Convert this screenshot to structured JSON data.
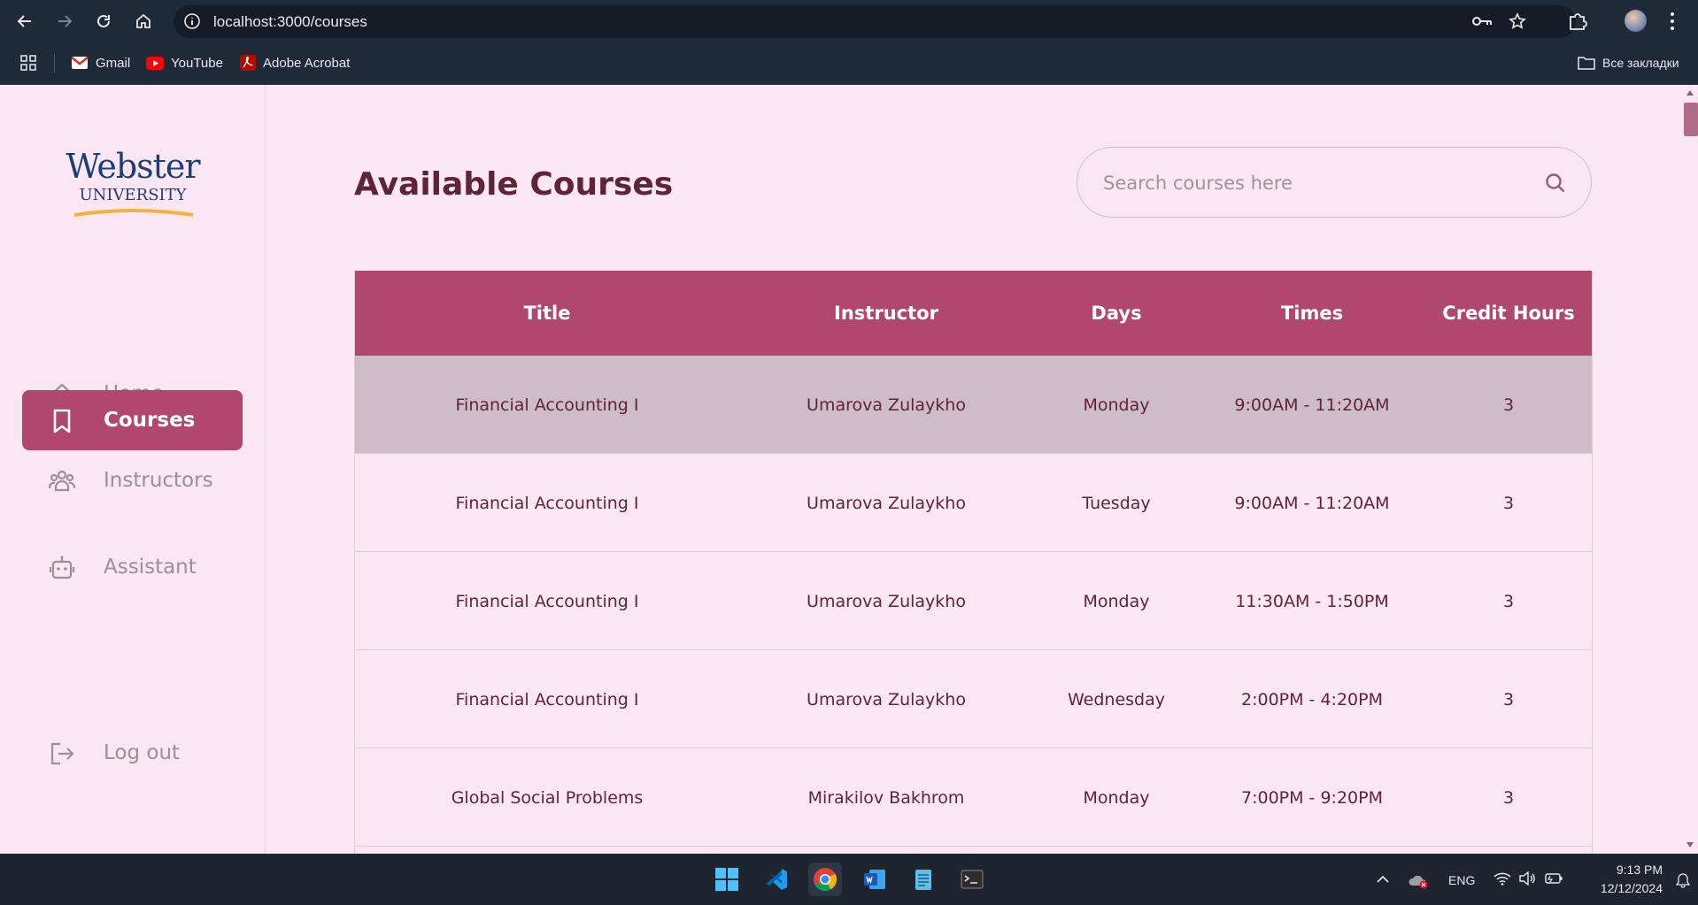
{
  "browser": {
    "url": "localhost:3000/courses",
    "bookmarks": [
      "Gmail",
      "YouTube",
      "Adobe Acrobat"
    ],
    "all_bookmarks": "Все закладки"
  },
  "sidebar": {
    "logo_line1": "Webster",
    "logo_line2": "UNIVERSITY",
    "items": [
      {
        "label": "Home",
        "icon": "home-icon"
      },
      {
        "label": "Courses",
        "icon": "bookmark-icon",
        "active": true
      },
      {
        "label": "Instructors",
        "icon": "users-icon"
      },
      {
        "label": "Assistant",
        "icon": "robot-icon"
      }
    ],
    "logout": "Log out"
  },
  "main": {
    "title": "Available Courses",
    "search_placeholder": "Search courses here",
    "columns": [
      "Title",
      "Instructor",
      "Days",
      "Times",
      "Credit Hours"
    ],
    "rows": [
      [
        "Financial Accounting I",
        "Umarova Zulaykho",
        "Monday",
        "9:00AM - 11:20AM",
        "3"
      ],
      [
        "Financial Accounting I",
        "Umarova Zulaykho",
        "Tuesday",
        "9:00AM - 11:20AM",
        "3"
      ],
      [
        "Financial Accounting I",
        "Umarova Zulaykho",
        "Monday",
        "11:30AM - 1:50PM",
        "3"
      ],
      [
        "Financial Accounting I",
        "Umarova Zulaykho",
        "Wednesday",
        "2:00PM - 4:20PM",
        "3"
      ],
      [
        "Global Social Problems",
        "Mirakilov Bakhrom",
        "Monday",
        "7:00PM - 9:20PM",
        "3"
      ]
    ]
  },
  "taskbar": {
    "lang": "ENG",
    "time": "9:13 PM",
    "date": "12/12/2024"
  },
  "colors": {
    "accent": "#b0476d",
    "background": "#fbe7f3",
    "selected_row": "#cebcc8",
    "text": "#5e2438"
  }
}
